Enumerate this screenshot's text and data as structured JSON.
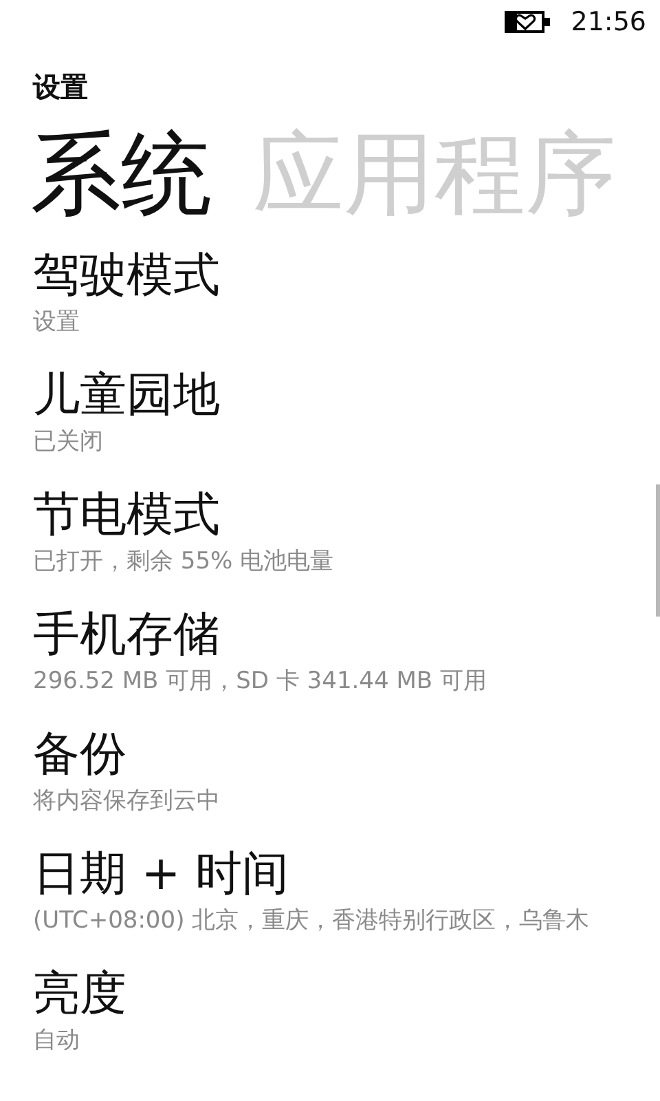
{
  "status_bar": {
    "time": "21:56"
  },
  "app_title": "设置",
  "pivot": [
    {
      "label": "系统",
      "selected": true
    },
    {
      "label": "应用程序",
      "selected": false
    }
  ],
  "items": [
    {
      "title": "驾驶模式",
      "subtitle": "设置"
    },
    {
      "title": "儿童园地",
      "subtitle": "已关闭"
    },
    {
      "title": "节电模式",
      "subtitle": "已打开，剩余 55% 电池电量"
    },
    {
      "title": "手机存储",
      "subtitle": "296.52 MB 可用，SD 卡 341.44 MB 可用"
    },
    {
      "title": "备份",
      "subtitle": "将内容保存到云中"
    },
    {
      "title": "日期 + 时间",
      "subtitle": "(UTC+08:00) 北京，重庆，香港特别行政区，乌鲁木"
    },
    {
      "title": "亮度",
      "subtitle": "自动"
    }
  ]
}
